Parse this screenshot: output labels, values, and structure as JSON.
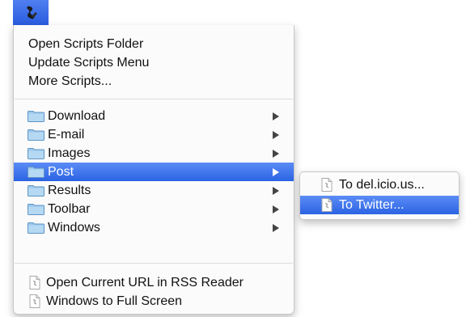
{
  "menubar": {
    "icon": "script-icon"
  },
  "menu": {
    "top_items": [
      {
        "label": "Open Scripts Folder"
      },
      {
        "label": "Update Scripts Menu"
      },
      {
        "label": "More Scripts..."
      }
    ],
    "folders": [
      {
        "label": "Download",
        "icon": "folder-icon",
        "has_submenu": true
      },
      {
        "label": "E-mail",
        "icon": "folder-icon",
        "has_submenu": true
      },
      {
        "label": "Images",
        "icon": "folder-icon",
        "has_submenu": true
      },
      {
        "label": "Post",
        "icon": "folder-icon",
        "has_submenu": true,
        "selected": true
      },
      {
        "label": "Results",
        "icon": "folder-icon",
        "has_submenu": true
      },
      {
        "label": "Toolbar",
        "icon": "folder-icon",
        "has_submenu": true
      },
      {
        "label": "Windows",
        "icon": "folder-icon",
        "has_submenu": true
      }
    ],
    "scripts": [
      {
        "label": "Open Current URL in RSS Reader",
        "icon": "script-document-icon"
      },
      {
        "label": "Windows to Full Screen",
        "icon": "script-document-icon"
      }
    ]
  },
  "submenu": {
    "items": [
      {
        "label": "To del.icio.us...",
        "icon": "script-document-icon"
      },
      {
        "label": "To Twitter...",
        "icon": "script-document-icon",
        "selected": true
      }
    ]
  },
  "colors": {
    "highlight": "#2b63e3",
    "folder": "#8fc2e9",
    "menu_background": "#fbfbfb"
  }
}
